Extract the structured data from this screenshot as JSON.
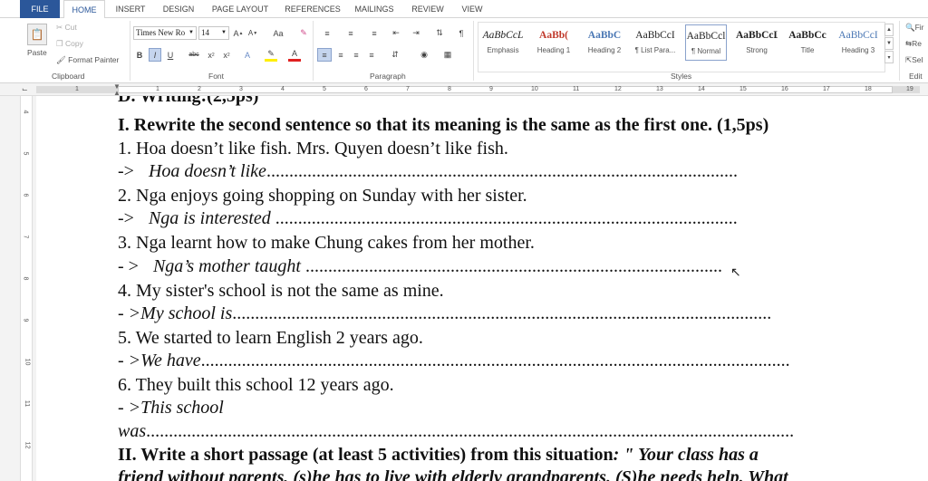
{
  "tabs": [
    "FILE",
    "HOME",
    "INSERT",
    "DESIGN",
    "PAGE LAYOUT",
    "REFERENCES",
    "MAILINGS",
    "REVIEW",
    "VIEW"
  ],
  "clipboard": {
    "paste": "Paste",
    "cut": "Cut",
    "copy": "Copy",
    "format_painter": "Format Painter",
    "label": "Clipboard"
  },
  "font": {
    "name": "Times New Ro",
    "size": "14",
    "case_btn": "Aa",
    "label": "Font"
  },
  "paragraph": {
    "label": "Paragraph"
  },
  "styles": {
    "label": "Styles",
    "items": [
      {
        "preview": "AaBbCcL",
        "name": "Emphasis",
        "color": "#222",
        "italic": true,
        "bold": false
      },
      {
        "preview": "AaBb(",
        "name": "Heading 1",
        "color": "#c0392b",
        "italic": false,
        "bold": true
      },
      {
        "preview": "AaBbC",
        "name": "Heading 2",
        "color": "#4a77b4",
        "italic": false,
        "bold": true
      },
      {
        "preview": "AaBbCcI",
        "name": "¶ List Para...",
        "color": "#222",
        "italic": false,
        "bold": false
      },
      {
        "preview": "AaBbCcl",
        "name": "¶ Normal",
        "color": "#222",
        "italic": false,
        "bold": false
      },
      {
        "preview": "AaBbCcL",
        "name": "Strong",
        "color": "#222",
        "italic": false,
        "bold": true
      },
      {
        "preview": "AaBbCc",
        "name": "Title",
        "color": "#222",
        "italic": false,
        "bold": true
      },
      {
        "preview": "AaBbCcI",
        "name": "Heading 3",
        "color": "#4a77b4",
        "italic": false,
        "bold": false
      }
    ]
  },
  "editing": {
    "find": "Fir",
    "replace": "Re",
    "select": "Sel",
    "label": "Edit"
  },
  "ruler_numbers": [
    "1",
    "1",
    "2",
    "3",
    "4",
    "5",
    "6",
    "7",
    "8",
    "9",
    "10",
    "11",
    "12",
    "13",
    "14",
    "15",
    "16",
    "17",
    "18",
    "19"
  ],
  "vruler_numbers": [
    "4",
    "5",
    "6",
    "7",
    "8",
    "9",
    "10",
    "11",
    "12"
  ],
  "document": {
    "line0": "D. Writing:(2,5ps)",
    "heading1": "I. Rewrite the second sentence so that its meaning is the same as the first one. (1,5ps)",
    "q1": "1.  Hoa doesn’t like fish. Mrs. Quyen doesn’t like fish.",
    "a1_prefix": "->",
    "a1": "Hoa doesn’t like",
    "q2": "2.  Nga enjoys going shopping on Sunday with her sister.",
    "a2_prefix": "->",
    "a2": "Nga is interested",
    "q3": "3.  Nga learnt how to make Chung cakes from her mother.",
    "a3_prefix": "- >",
    "a3": "Nga’s mother taught",
    "q4": "4. My sister's school is not the same as mine.",
    "a4": "- >My school is",
    "q5": "5. We started to learn English 2 years ago.",
    "a5": "- >We have",
    "q6": "6. They built this school 12 years ago.",
    "a6": "- >This school",
    "a6b": "was",
    "heading2_bold": "II. Write a short passage (at least 5 activities) from this situation",
    "heading2_rest": ": \" Your class has a",
    "line_last": "friend without parents, (s)he has to live with elderly grandparents. (S)he needs help. What"
  }
}
